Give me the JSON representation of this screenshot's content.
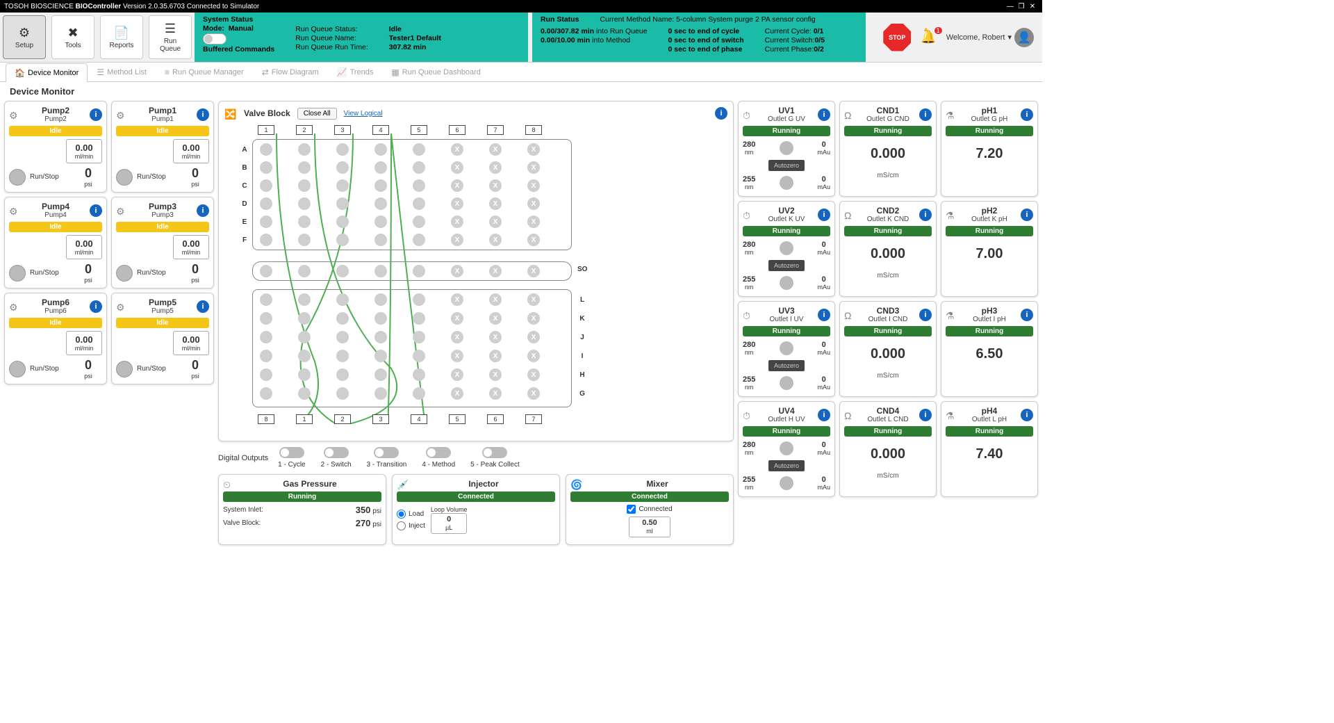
{
  "titlebar": {
    "brand": "TOSOH BIOSCIENCE",
    "app": "BIOController",
    "version": "Version 2.0.35.6703",
    "connection": "Connected to Simulator"
  },
  "ribbon": {
    "setup": "Setup",
    "tools": "Tools",
    "reports": "Reports",
    "runqueue": "Run\nQueue"
  },
  "system_status": {
    "title": "System Status",
    "mode_label": "Mode:",
    "mode": "Manual",
    "rqs_l": "Run Queue Status:",
    "rqs_v": "Idle",
    "rqn_l": "Run Queue Name:",
    "rqn_v": "Tester1 Default",
    "rqt_l": "Run Queue Run Time:",
    "rqt_v": "307.82 min",
    "buffered": "Buffered Commands"
  },
  "run_status": {
    "title": "Run Status",
    "cmn_l": "Current Method Name:",
    "cmn_v": "5-column System purge 2 PA sensor config",
    "rq_time": "0.00/307.82 min",
    "rq_into": "into Run Queue",
    "me_time": "0.00/10.00 min",
    "me_into": "into Method",
    "cycle_end": "0 sec to end of cycle",
    "switch_end": "0 sec to end of switch",
    "phase_end": "0 sec to end of phase",
    "cc_l": "Current Cycle:",
    "cc_v": "0/1",
    "cs_l": "Current Switch:",
    "cs_v": "0/5",
    "cp_l": "Current Phase:",
    "cp_v": "0/2"
  },
  "stop": "STOP",
  "bell_count": "1",
  "welcome": "Welcome, Robert",
  "tabs": {
    "device": "Device Monitor",
    "method": "Method List",
    "rqm": "Run Queue Manager",
    "flow": "Flow Diagram",
    "trends": "Trends",
    "rqd": "Run Queue Dashboard"
  },
  "subtitle": "Device Monitor",
  "pumps": [
    {
      "name": "Pump2",
      "sub": "Pump2",
      "status": "Idle",
      "flow": "0.00",
      "flow_unit": "ml/min",
      "press": "0",
      "press_unit": "psi",
      "runstop": "Run/Stop"
    },
    {
      "name": "Pump1",
      "sub": "Pump1",
      "status": "Idle",
      "flow": "0.00",
      "flow_unit": "ml/min",
      "press": "0",
      "press_unit": "psi",
      "runstop": "Run/Stop"
    },
    {
      "name": "Pump4",
      "sub": "Pump4",
      "status": "Idle",
      "flow": "0.00",
      "flow_unit": "ml/min",
      "press": "0",
      "press_unit": "psi",
      "runstop": "Run/Stop"
    },
    {
      "name": "Pump3",
      "sub": "Pump3",
      "status": "Idle",
      "flow": "0.00",
      "flow_unit": "ml/min",
      "press": "0",
      "press_unit": "psi",
      "runstop": "Run/Stop"
    },
    {
      "name": "Pump6",
      "sub": "Pump6",
      "status": "Idle",
      "flow": "0.00",
      "flow_unit": "ml/min",
      "press": "0",
      "press_unit": "psi",
      "runstop": "Run/Stop"
    },
    {
      "name": "Pump5",
      "sub": "Pump5",
      "status": "Idle",
      "flow": "0.00",
      "flow_unit": "ml/min",
      "press": "0",
      "press_unit": "psi",
      "runstop": "Run/Stop"
    }
  ],
  "valve": {
    "title": "Valve Block",
    "close_all": "Close All",
    "view_logical": "View Logical",
    "top_ports": [
      "1",
      "2",
      "3",
      "4",
      "5",
      "6",
      "7",
      "8"
    ],
    "rows_top": [
      "A",
      "B",
      "C",
      "D",
      "E",
      "F"
    ],
    "so_label": "SO",
    "rows_bot": [
      "L",
      "K",
      "J",
      "I",
      "H",
      "G"
    ],
    "bot_ports": [
      "8",
      "1",
      "2",
      "3",
      "4",
      "5",
      "6",
      "7"
    ]
  },
  "digout": {
    "title": "Digital Outputs",
    "items": [
      "1 - Cycle",
      "2 - Switch",
      "3 - Transition",
      "4 - Method",
      "5 - Peak Collect"
    ]
  },
  "gas": {
    "title": "Gas Pressure",
    "status": "Running",
    "si_l": "System Inlet:",
    "si_v": "350",
    "si_u": "psi",
    "vb_l": "Valve Block:",
    "vb_v": "270",
    "vb_u": "psi"
  },
  "injector": {
    "title": "Injector",
    "status": "Connected",
    "load": "Load",
    "inject": "Inject",
    "lv_l": "Loop Volume",
    "lv_v": "0",
    "lv_u": "µL"
  },
  "mixer": {
    "title": "Mixer",
    "status": "Connected",
    "cbx": "Connected",
    "val": "0.50",
    "unit": "ml"
  },
  "uvs": [
    {
      "name": "UV1",
      "sub": "Outlet G UV",
      "status": "Running",
      "wl1": "280",
      "wl1u": "nm",
      "v1": "0",
      "v1u": "mAu",
      "az": "Autozero",
      "wl2": "255",
      "wl2u": "nm",
      "v2": "0",
      "v2u": "mAu"
    },
    {
      "name": "UV2",
      "sub": "Outlet K UV",
      "status": "Running",
      "wl1": "280",
      "wl1u": "nm",
      "v1": "0",
      "v1u": "mAu",
      "az": "Autozero",
      "wl2": "255",
      "wl2u": "nm",
      "v2": "0",
      "v2u": "mAu"
    },
    {
      "name": "UV3",
      "sub": "Outlet I UV",
      "status": "Running",
      "wl1": "280",
      "wl1u": "nm",
      "v1": "0",
      "v1u": "mAu",
      "az": "Autozero",
      "wl2": "255",
      "wl2u": "nm",
      "v2": "0",
      "v2u": "mAu"
    },
    {
      "name": "UV4",
      "sub": "Outlet H UV",
      "status": "Running",
      "wl1": "280",
      "wl1u": "nm",
      "v1": "0",
      "v1u": "mAu",
      "az": "Autozero",
      "wl2": "255",
      "wl2u": "nm",
      "v2": "0",
      "v2u": "mAu"
    }
  ],
  "cnds": [
    {
      "name": "CND1",
      "sub": "Outlet G CND",
      "status": "Running",
      "val": "0.000",
      "unit": "mS/cm"
    },
    {
      "name": "CND2",
      "sub": "Outlet K CND",
      "status": "Running",
      "val": "0.000",
      "unit": "mS/cm"
    },
    {
      "name": "CND3",
      "sub": "Outlet I CND",
      "status": "Running",
      "val": "0.000",
      "unit": "mS/cm"
    },
    {
      "name": "CND4",
      "sub": "Outlet L CND",
      "status": "Running",
      "val": "0.000",
      "unit": "mS/cm"
    }
  ],
  "phs": [
    {
      "name": "pH1",
      "sub": "Outlet G pH",
      "status": "Running",
      "val": "7.20"
    },
    {
      "name": "pH2",
      "sub": "Outlet K pH",
      "status": "Running",
      "val": "7.00"
    },
    {
      "name": "pH3",
      "sub": "Outlet I pH",
      "status": "Running",
      "val": "6.50"
    },
    {
      "name": "pH4",
      "sub": "Outlet L pH",
      "status": "Running",
      "val": "7.40"
    }
  ]
}
